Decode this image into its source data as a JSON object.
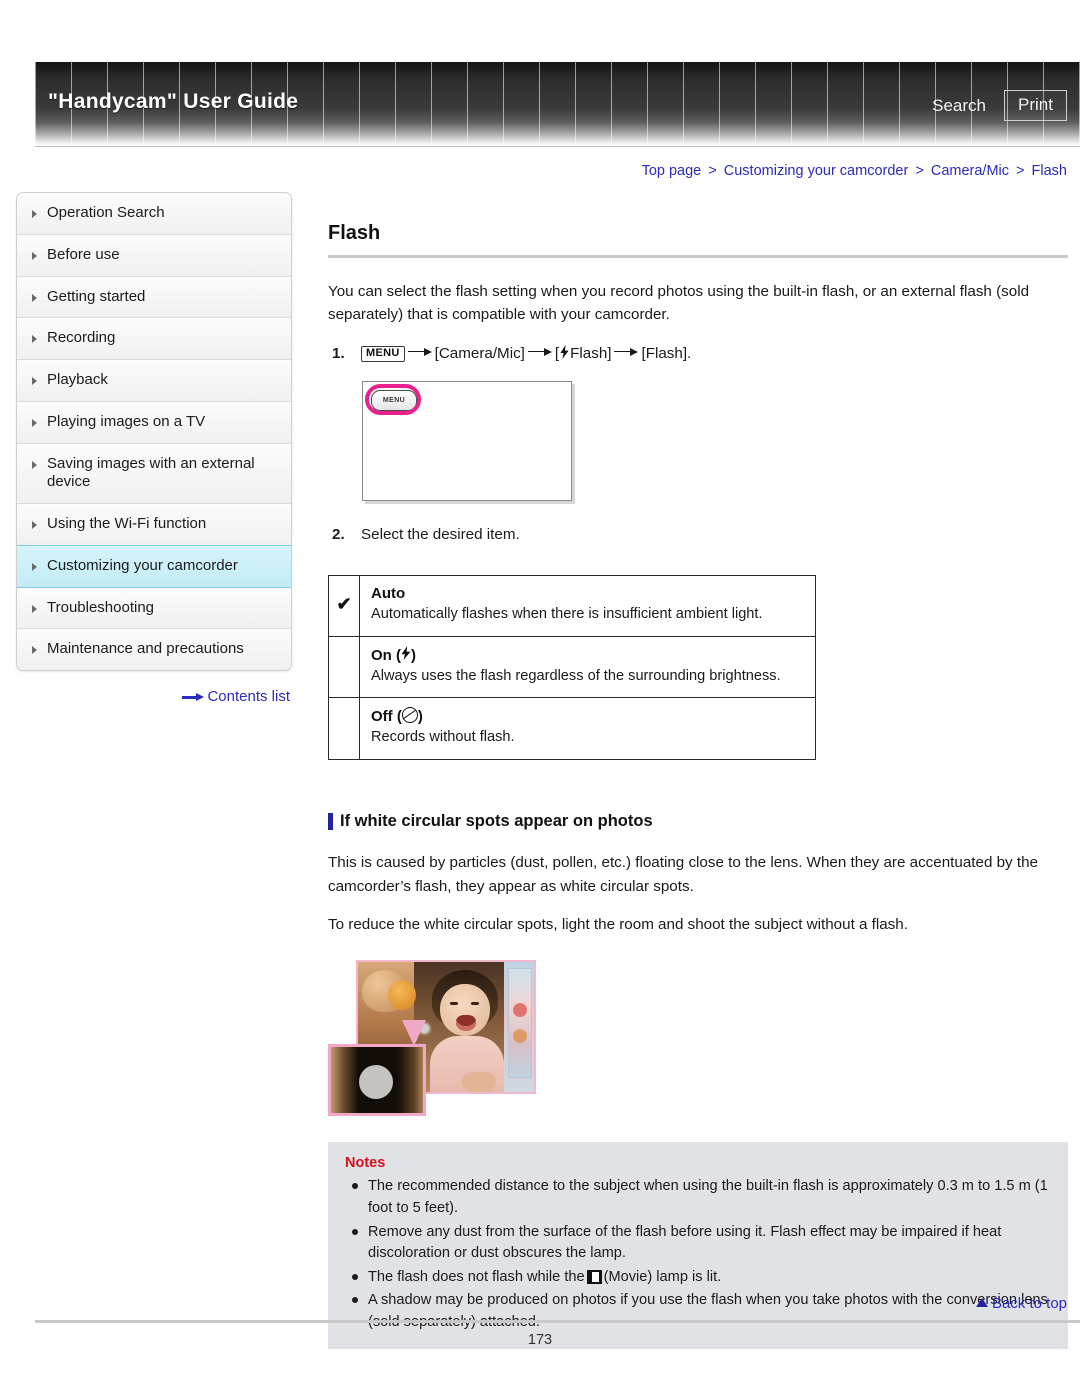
{
  "header": {
    "site_title": "\"Handycam\" User Guide",
    "search_label": "Search",
    "print_label": "Print"
  },
  "breadcrumb": {
    "items": [
      "Top page",
      "Customizing your camcorder",
      "Camera/Mic",
      "Flash"
    ],
    "separator": ">"
  },
  "sidebar": {
    "items": [
      {
        "label": "Operation Search",
        "active": false
      },
      {
        "label": "Before use",
        "active": false
      },
      {
        "label": "Getting started",
        "active": false
      },
      {
        "label": "Recording",
        "active": false
      },
      {
        "label": "Playback",
        "active": false
      },
      {
        "label": "Playing images on a TV",
        "active": false
      },
      {
        "label": "Saving images with an external device",
        "active": false
      },
      {
        "label": "Using the Wi-Fi function",
        "active": false
      },
      {
        "label": "Customizing your camcorder",
        "active": true
      },
      {
        "label": "Troubleshooting",
        "active": false
      },
      {
        "label": "Maintenance and precautions",
        "active": false
      }
    ],
    "contents_list_label": "Contents list"
  },
  "main": {
    "title": "Flash",
    "intro": "You can select the flash setting when you record photos using the built-in flash, or an external flash (sold separately) that is compatible with your camcorder.",
    "steps": [
      {
        "number": "1.",
        "menu_chip": "MENU",
        "part_a": "[Camera/Mic]",
        "part_b_prefix": "[",
        "part_b": "Flash]",
        "part_c": "[Flash]."
      },
      {
        "number": "2.",
        "text": "Select the desired item."
      }
    ],
    "screenshot": {
      "menu_key_label": "MENU",
      "highlight_color": "#e8218c"
    },
    "options_table": {
      "rows": [
        {
          "checked": "✔",
          "name": "Auto",
          "icon": "",
          "description": "Automatically flashes when there is insufficient ambient light."
        },
        {
          "checked": "",
          "name": "On",
          "icon": "flash-on-icon",
          "description": "Always uses the flash regardless of the surrounding brightness."
        },
        {
          "checked": "",
          "name": "Off",
          "icon": "flash-off-icon",
          "description": "Records without flash."
        }
      ]
    },
    "subsection": {
      "heading": "If white circular spots appear on photos",
      "paragraph_1": "This is caused by particles (dust, pollen, etc.) floating close to the lens. When they are accentuated by the camcorder’s flash, they appear as white circular spots.",
      "paragraph_2": "To reduce the white circular spots, light the room and shoot the subject without a flash."
    },
    "notes": {
      "title": "Notes",
      "items": [
        {
          "text_before": "The recommended distance to the subject when using the built-in flash is approximately 0.3 m to 1.5 m (1 foot to 5 feet).",
          "icon": "",
          "text_after": ""
        },
        {
          "text_before": "Remove any dust from the surface of the flash before using it. Flash effect may be impaired if heat discoloration or dust obscures the lamp.",
          "icon": "",
          "text_after": ""
        },
        {
          "text_before": "The flash does not flash while the",
          "icon": "movie-icon",
          "text_after": "(Movie) lamp is lit."
        },
        {
          "text_before": "A shadow may be produced on photos if you use the flash when you take photos with the conversion lens (sold separately) attached.",
          "icon": "",
          "text_after": ""
        }
      ]
    }
  },
  "footer": {
    "back_to_top_label": "Back to top",
    "page_number": "173"
  },
  "colors": {
    "link": "#2b2bbd",
    "notes_title": "#d5111b",
    "accent_bar": "#23239e",
    "highlight_row": "#c3ecf7",
    "magenta": "#e8218c"
  }
}
